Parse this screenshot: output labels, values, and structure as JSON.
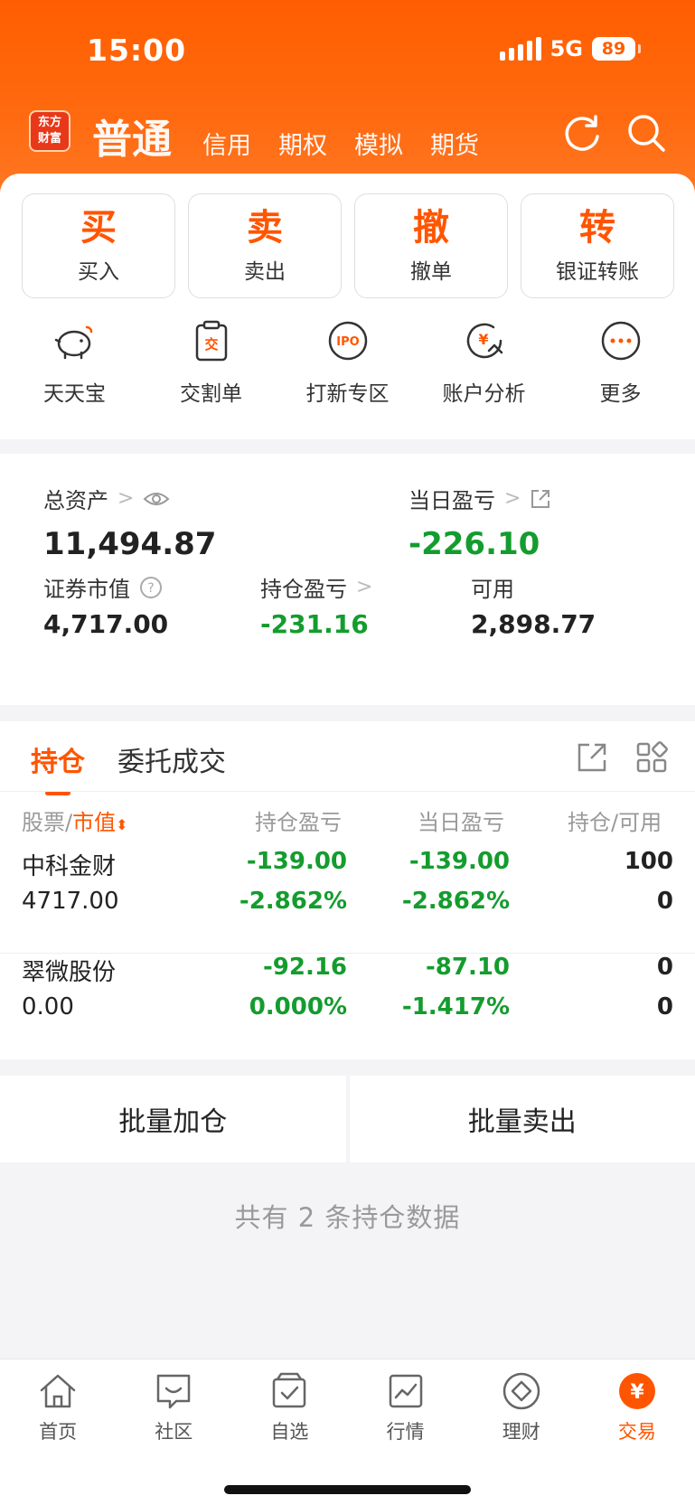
{
  "status": {
    "time": "15:00",
    "network": "5G",
    "battery": "89"
  },
  "header": {
    "logo_line1": "东方",
    "logo_line2": "财富",
    "tabs": [
      {
        "label": "普通"
      },
      {
        "label": "信用"
      },
      {
        "label": "期权"
      },
      {
        "label": "模拟"
      },
      {
        "label": "期货"
      }
    ],
    "icons": [
      "refresh-icon",
      "search-icon"
    ]
  },
  "quick_actions": [
    {
      "big": "买",
      "small": "买入"
    },
    {
      "big": "卖",
      "small": "卖出"
    },
    {
      "big": "撤",
      "small": "撤单"
    },
    {
      "big": "转",
      "small": "银证转账"
    }
  ],
  "tools": [
    {
      "label": "天天宝",
      "icon": "piggy-bank-icon"
    },
    {
      "label": "交割单",
      "icon": "clipboard-icon",
      "glyph": "交"
    },
    {
      "label": "打新专区",
      "icon": "ipo-icon",
      "glyph": "IPO"
    },
    {
      "label": "账户分析",
      "icon": "yuan-chart-icon",
      "glyph": "¥"
    },
    {
      "label": "更多",
      "icon": "more-icon"
    }
  ],
  "assets": {
    "total_label": "总资产",
    "total_value": "11,494.87",
    "daily_label": "当日盈亏",
    "daily_value": "-226.10",
    "market_label": "证券市值",
    "market_value": "4,717.00",
    "position_pl_label": "持仓盈亏",
    "position_pl_value": "-231.16",
    "available_label": "可用",
    "available_value": "2,898.77"
  },
  "holdings": {
    "tabs": [
      {
        "label": "持仓"
      },
      {
        "label": "委托成交"
      }
    ],
    "headers": {
      "stock": "股票",
      "sep": "/",
      "market_value": "市值",
      "position_pl": "持仓盈亏",
      "daily_pl": "当日盈亏",
      "position_avail": "持仓/可用"
    },
    "rows": [
      {
        "name": "中科金财",
        "market_value": "4717.00",
        "pl": "-139.00",
        "pl_pct": "-2.862%",
        "daily": "-139.00",
        "daily_pct": "-2.862%",
        "position": "100",
        "available": "0"
      },
      {
        "name": "翠微股份",
        "market_value": "0.00",
        "pl": "-92.16",
        "pl_pct": "0.000%",
        "daily": "-87.10",
        "daily_pct": "-1.417%",
        "position": "0",
        "available": "0"
      }
    ]
  },
  "batch": {
    "add": "批量加仓",
    "sell": "批量卖出"
  },
  "summary": "共有 2 条持仓数据",
  "bottom_nav": [
    {
      "label": "首页",
      "icon": "home-icon"
    },
    {
      "label": "社区",
      "icon": "community-icon"
    },
    {
      "label": "自选",
      "icon": "watchlist-icon"
    },
    {
      "label": "行情",
      "icon": "market-icon"
    },
    {
      "label": "理财",
      "icon": "wealth-icon"
    },
    {
      "label": "交易",
      "icon": "trade-icon",
      "glyph": "¥"
    }
  ],
  "colors": {
    "accent": "#ff5500",
    "header": "#ff5e00",
    "loss": "#149c2e"
  }
}
